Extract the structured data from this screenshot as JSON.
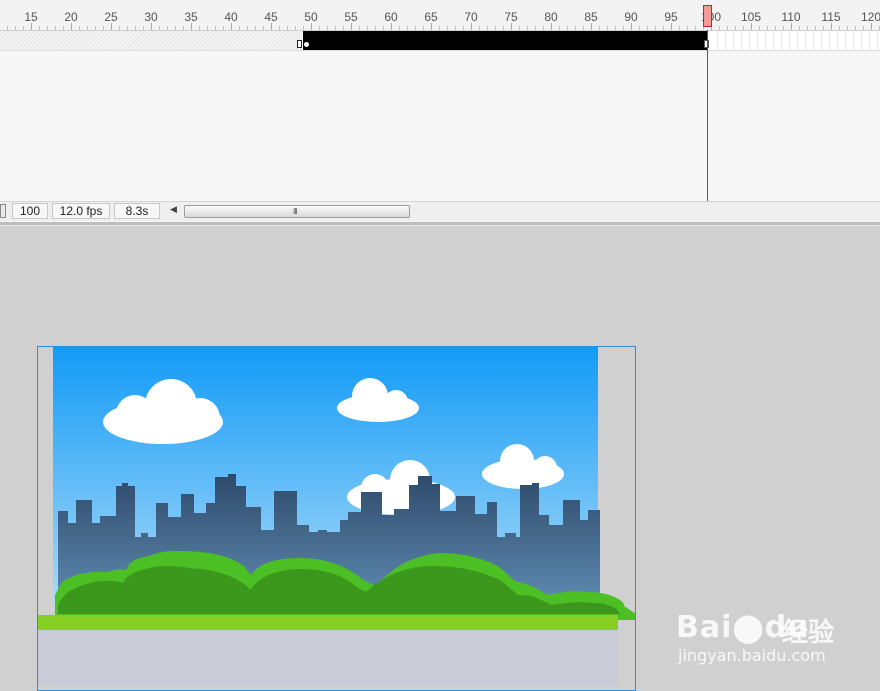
{
  "timeline": {
    "ruler_labels": [
      "15",
      "20",
      "25",
      "30",
      "35",
      "40",
      "45",
      "50",
      "55",
      "60",
      "65",
      "70",
      "75",
      "80",
      "85",
      "90",
      "95",
      "100",
      "105",
      "110",
      "115",
      "120"
    ],
    "current_frame": "100",
    "frame_rate": "12.0 fps",
    "elapsed_time": "8.3s",
    "scroll_grip": "III"
  },
  "watermark": {
    "brand": "Bai",
    "brand_paw": "du",
    "product": "经验",
    "url": "jingyan.baidu.com"
  },
  "colors": {
    "sky_top": "#129bf7",
    "sky_bottom": "#a9daf7",
    "buildings": "#2f4f6f",
    "hill_light": "#4bbf24",
    "hill_dark": "#3b981c",
    "ground_strip": "#86cf22",
    "ground_base": "#c9ccd6",
    "playhead": "#c0282a",
    "stage_border": "#2a8fe0"
  }
}
